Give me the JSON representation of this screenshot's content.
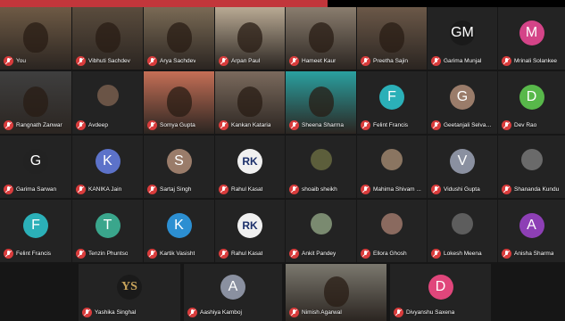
{
  "participants": [
    {
      "name": "You",
      "avatar_text": "",
      "color": "#6e5a45",
      "type": "video"
    },
    {
      "name": "Vibhuti Sachdev",
      "avatar_text": "",
      "color": "#5a4c3d",
      "type": "video"
    },
    {
      "name": "Arya Sachdev",
      "avatar_text": "",
      "color": "#7a6a55",
      "type": "video"
    },
    {
      "name": "Arpan Paul",
      "avatar_text": "",
      "color": "#b9aa94",
      "type": "video"
    },
    {
      "name": "Hameet Kaur",
      "avatar_text": "",
      "color": "#8a7d6e",
      "type": "video"
    },
    {
      "name": "Preetha Sajin",
      "avatar_text": "",
      "color": "#6b5848",
      "type": "video"
    },
    {
      "name": "Garima Munjal",
      "avatar_text": "GM",
      "color": "#1a1a1a",
      "type": "avatar"
    },
    {
      "name": "Mrinali Solankee",
      "avatar_text": "M",
      "color": "#d44488",
      "type": "avatar"
    },
    {
      "name": "Rangnath Zanwar",
      "avatar_text": "",
      "color": "#3f3f3f",
      "type": "video"
    },
    {
      "name": "Avdeep",
      "avatar_text": "",
      "color": "#6a5446",
      "type": "photo"
    },
    {
      "name": "Somya Gupta",
      "avatar_text": "",
      "color": "#c56f56",
      "type": "video"
    },
    {
      "name": "Kankan Kataria",
      "avatar_text": "",
      "color": "#7b6a5d",
      "type": "video"
    },
    {
      "name": "Sheena Sharma",
      "avatar_text": "",
      "color": "#2aa0a0",
      "type": "video"
    },
    {
      "name": "Felint Francis",
      "avatar_text": "F",
      "color": "#2bb0b8",
      "type": "avatar"
    },
    {
      "name": "Geetanjali Selvad...",
      "avatar_text": "G",
      "color": "#9a7c6a",
      "type": "avatar"
    },
    {
      "name": "Dev Rao",
      "avatar_text": "D",
      "color": "#58b84a",
      "type": "avatar"
    },
    {
      "name": "Garima Sarwan",
      "avatar_text": "G",
      "color": "#222",
      "type": "avatar"
    },
    {
      "name": "KANIKA Jain",
      "avatar_text": "K",
      "color": "#5c72c9",
      "type": "avatar"
    },
    {
      "name": "Sartaj Singh",
      "avatar_text": "S",
      "color": "#9a7c6a",
      "type": "avatar"
    },
    {
      "name": "Rahul Kasat",
      "avatar_text": "RK",
      "color": "#f0f0f0",
      "type": "logo"
    },
    {
      "name": "shoaib sheikh",
      "avatar_text": "",
      "color": "#5c5e3b",
      "type": "photo"
    },
    {
      "name": "Mahima Shivam ...",
      "avatar_text": "",
      "color": "#8a7561",
      "type": "photo"
    },
    {
      "name": "Vidushi Gupta",
      "avatar_text": "V",
      "color": "#8a90a0",
      "type": "avatar"
    },
    {
      "name": "Shananda Kundu",
      "avatar_text": "",
      "color": "#6a6a6a",
      "type": "photo"
    },
    {
      "name": "Felint Francis",
      "avatar_text": "F",
      "color": "#2bb0b8",
      "type": "avatar"
    },
    {
      "name": "Tenzin Phuntso",
      "avatar_text": "T",
      "color": "#3aa68c",
      "type": "avatar"
    },
    {
      "name": "Kartik Vasisht",
      "avatar_text": "K",
      "color": "#2c8fd2",
      "type": "avatar"
    },
    {
      "name": "Rahul Kasat",
      "avatar_text": "RK",
      "color": "#f0f0f0",
      "type": "logo"
    },
    {
      "name": "Ankit Pandey",
      "avatar_text": "",
      "color": "#7a8a70",
      "type": "photo"
    },
    {
      "name": "Ellora Ghosh",
      "avatar_text": "",
      "color": "#8a6a5f",
      "type": "photo"
    },
    {
      "name": "Lokesh Meena",
      "avatar_text": "",
      "color": "#5d5d5d",
      "type": "photo"
    },
    {
      "name": "Anisha Sharma",
      "avatar_text": "A",
      "color": "#8d3fb5",
      "type": "avatar"
    }
  ],
  "bottom_row": [
    {
      "name": "Yashika Singhal",
      "avatar_text": "YS",
      "color": "#1a1a1a",
      "type": "logo2"
    },
    {
      "name": "Aashiya Kamboj",
      "avatar_text": "A",
      "color": "#8a90a0",
      "type": "avatar"
    },
    {
      "name": "Nimish Agarwal",
      "avatar_text": "",
      "color": "#7b786e",
      "type": "video"
    },
    {
      "name": "Divyanshu Saxena",
      "avatar_text": "D",
      "color": "#e0467b",
      "type": "avatar"
    }
  ]
}
